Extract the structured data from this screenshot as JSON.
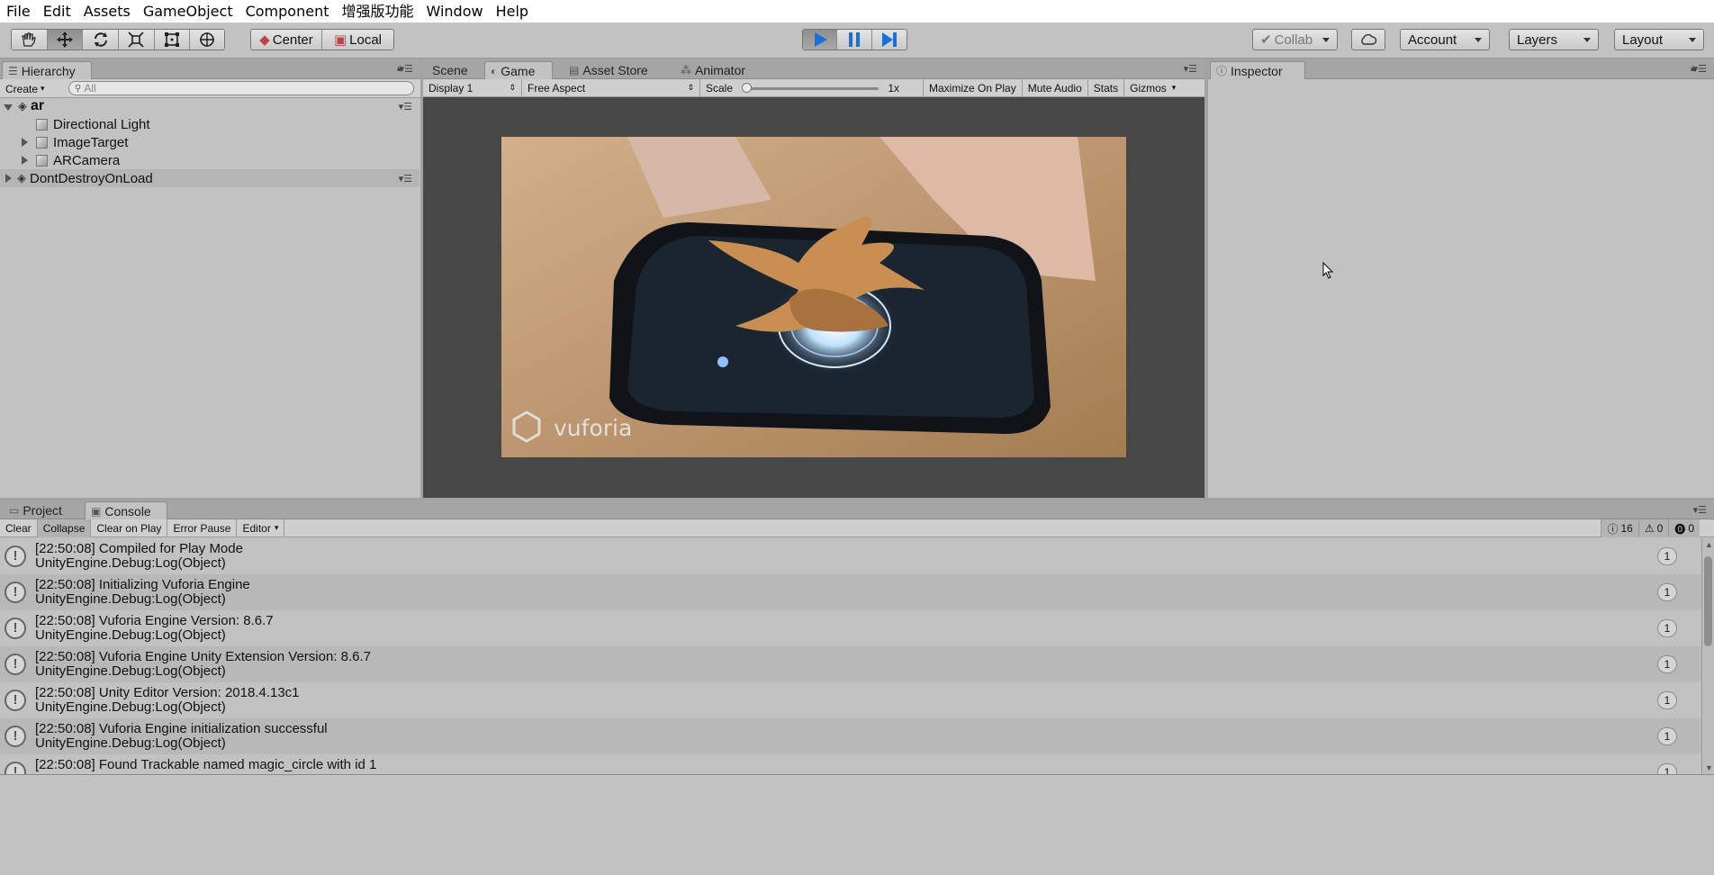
{
  "menubar": [
    "File",
    "Edit",
    "Assets",
    "GameObject",
    "Component",
    "增强版功能",
    "Window",
    "Help"
  ],
  "toolbar": {
    "tools": [
      "hand-icon",
      "move-icon",
      "rotate-icon",
      "scale-icon",
      "rect-icon",
      "transform-icon"
    ],
    "pivot_label": "Center",
    "space_label": "Local",
    "collab_label": "Collab",
    "account_label": "Account",
    "layers_label": "Layers",
    "layout_label": "Layout"
  },
  "hierarchy": {
    "tab_label": "Hierarchy",
    "create_label": "Create",
    "search_placeholder": "All",
    "scene_name": "ar",
    "items": [
      {
        "label": "Directional Light"
      },
      {
        "label": "ImageTarget"
      },
      {
        "label": "ARCamera"
      }
    ],
    "dontdestroy_label": "DontDestroyOnLoad"
  },
  "center": {
    "tabs": [
      "Scene",
      "Game",
      "Asset Store",
      "Animator"
    ],
    "display_label": "Display 1",
    "aspect_label": "Free Aspect",
    "scale_label": "Scale",
    "scale_value": "1x",
    "toggles": [
      "Maximize On Play",
      "Mute Audio",
      "Stats",
      "Gizmos"
    ],
    "watermark": "vuforia"
  },
  "inspector": {
    "tab_label": "Inspector"
  },
  "bottom": {
    "tabs": [
      "Project",
      "Console"
    ],
    "buttons": [
      "Clear",
      "Collapse",
      "Clear on Play",
      "Error Pause",
      "Editor"
    ],
    "counts": {
      "info": "16",
      "warn": "0",
      "error": "0"
    },
    "logs": [
      {
        "line1": "[22:50:08] Compiled for Play Mode",
        "line2": "UnityEngine.Debug:Log(Object)",
        "count": "1"
      },
      {
        "line1": "[22:50:08] Initializing Vuforia Engine",
        "line2": "UnityEngine.Debug:Log(Object)",
        "count": "1"
      },
      {
        "line1": "[22:50:08] Vuforia Engine Version: 8.6.7",
        "line2": "UnityEngine.Debug:Log(Object)",
        "count": "1"
      },
      {
        "line1": "[22:50:08] Vuforia Engine Unity Extension Version: 8.6.7",
        "line2": "UnityEngine.Debug:Log(Object)",
        "count": "1"
      },
      {
        "line1": "[22:50:08] Unity Editor Version: 2018.4.13c1",
        "line2": "UnityEngine.Debug:Log(Object)",
        "count": "1"
      },
      {
        "line1": "[22:50:08] Vuforia Engine initialization successful",
        "line2": "UnityEngine.Debug:Log(Object)",
        "count": "1"
      },
      {
        "line1": "[22:50:08] Found Trackable named magic_circle with id 1",
        "line2": "",
        "count": "1"
      }
    ]
  }
}
